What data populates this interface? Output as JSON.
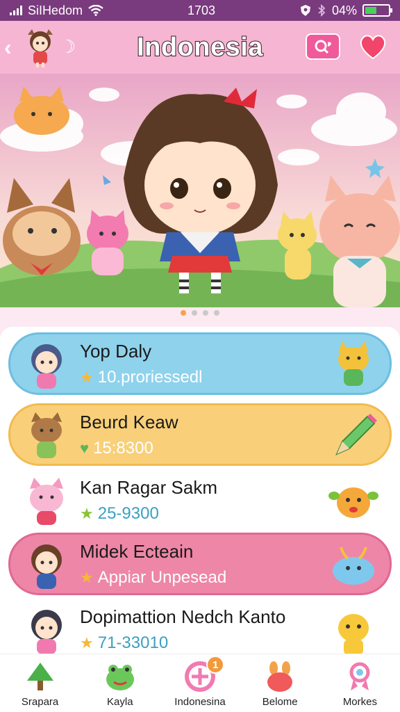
{
  "status": {
    "carrier": "SiIHedom",
    "time": "1703",
    "battery_percent": "04%",
    "battery_level": 0.5
  },
  "header": {
    "title": "Indonesia",
    "accent": "#f6b5d2",
    "search_icon": "search-icon",
    "heart_icon": "heart-icon"
  },
  "banner": {
    "page_dots": 4,
    "active_dot": 0
  },
  "cards": [
    {
      "name": "Yop Daly",
      "icon": "star",
      "sub": "10.proriessedl",
      "color": "#8fd2ec"
    },
    {
      "name": "Beurd Keaw",
      "icon": "heart",
      "sub": "15:8300",
      "color": "#f9d079"
    },
    {
      "name": "Kan Ragar Sakm",
      "icon": "star",
      "sub": "25-9300",
      "color": "#ffffff"
    },
    {
      "name": "Midek Ecteain",
      "icon": "star",
      "sub": "Appiar Unpesead",
      "color": "#ee86a8"
    },
    {
      "name": "Dopimattion Nedch Kanto",
      "icon": "star",
      "sub": "71-33010",
      "color": "#ffffff"
    }
  ],
  "tabs": [
    {
      "label": "Srapara",
      "icon": "tree-icon"
    },
    {
      "label": "Kayla",
      "icon": "frog-icon"
    },
    {
      "label": "Indonesina",
      "icon": "home-plus-icon",
      "badge": "1"
    },
    {
      "label": "Belome",
      "icon": "bunny-icon"
    },
    {
      "label": "Morkes",
      "icon": "ribbon-icon"
    }
  ]
}
